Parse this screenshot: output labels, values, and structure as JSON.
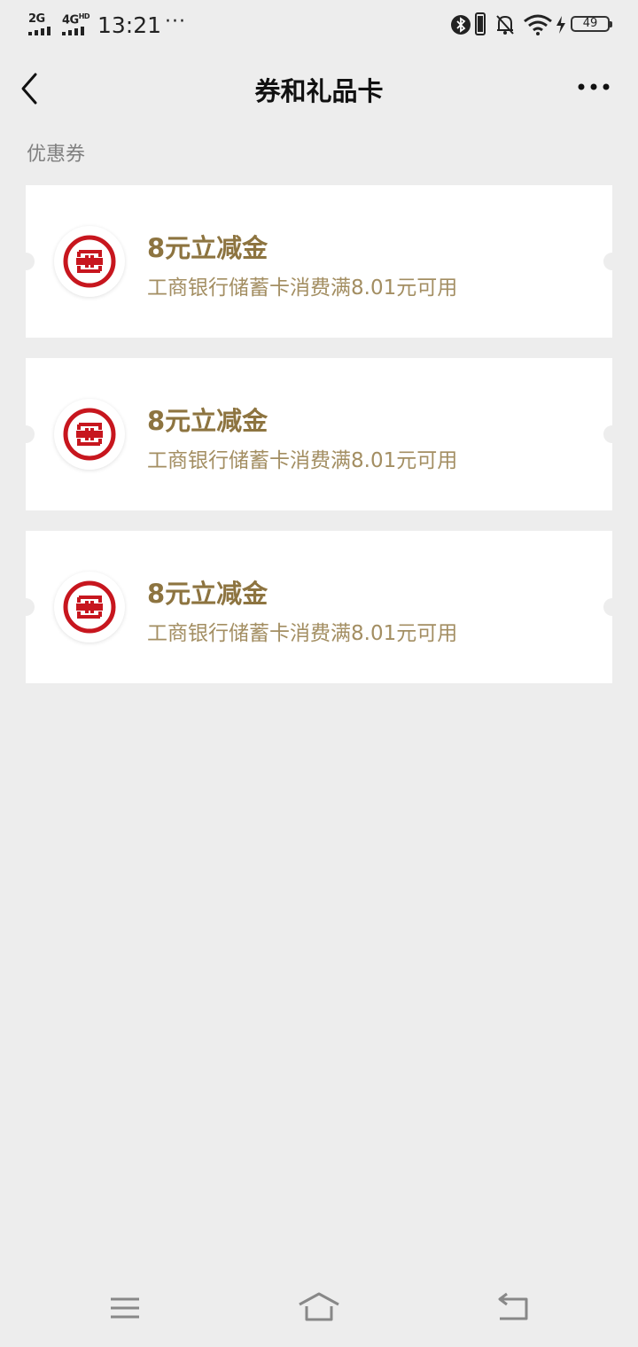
{
  "status_bar": {
    "signal1_label": "2G",
    "signal2_label": "4G",
    "signal2_sup": "HD",
    "time": "13:21",
    "dots": "···",
    "battery_level": "49"
  },
  "header": {
    "title": "券和礼品卡"
  },
  "section": {
    "label": "优惠券"
  },
  "coupons": [
    {
      "title": "8元立减金",
      "description": "工商银行储蓄卡消费满8.01元可用",
      "icon": "icbc-logo-icon"
    },
    {
      "title": "8元立减金",
      "description": "工商银行储蓄卡消费满8.01元可用",
      "icon": "icbc-logo-icon"
    },
    {
      "title": "8元立减金",
      "description": "工商银行储蓄卡消费满8.01元可用",
      "icon": "icbc-logo-icon"
    }
  ],
  "colors": {
    "background": "#ededed",
    "coupon_title": "#8d7440",
    "coupon_desc": "#a38e62",
    "icbc_red": "#c7161e"
  },
  "system_nav": [
    "menu-icon",
    "home-icon",
    "back-icon"
  ]
}
